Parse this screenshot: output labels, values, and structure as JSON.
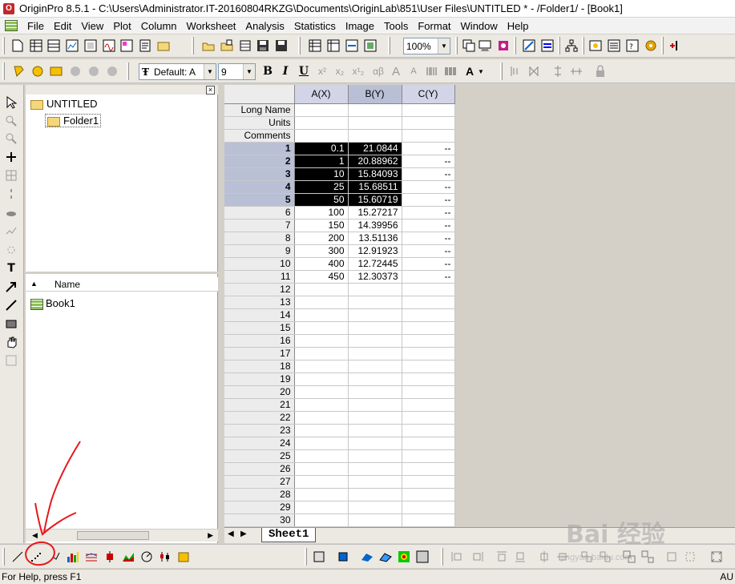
{
  "window": {
    "title": "OriginPro 8.5.1 - C:\\Users\\Administrator.IT-20160804RKZG\\Documents\\OriginLab\\851\\User Files\\UNTITLED * - /Folder1/ - [Book1]"
  },
  "menu": [
    "File",
    "Edit",
    "View",
    "Plot",
    "Column",
    "Worksheet",
    "Analysis",
    "Statistics",
    "Image",
    "Tools",
    "Format",
    "Window",
    "Help"
  ],
  "toolbar": {
    "zoom": "100%",
    "font_name": "Default: A",
    "font_size": "9",
    "bold": "B",
    "italic": "I",
    "underline": "U",
    "greek": "αβ",
    "font_grow": "A",
    "font_shrink": "A"
  },
  "project_explorer": {
    "root": "UNTITLED",
    "folder": "Folder1",
    "name_header": "Name",
    "items": [
      "Book1"
    ]
  },
  "worksheet": {
    "columns": [
      "A(X)",
      "B(Y)",
      "C(Y)"
    ],
    "meta_rows": [
      "Long Name",
      "Units",
      "Comments"
    ],
    "rows": [
      {
        "n": "1",
        "a": "0.1",
        "b": "21.0844",
        "c": "--"
      },
      {
        "n": "2",
        "a": "1",
        "b": "20.88962",
        "c": "--"
      },
      {
        "n": "3",
        "a": "10",
        "b": "15.84093",
        "c": "--"
      },
      {
        "n": "4",
        "a": "25",
        "b": "15.68511",
        "c": "--"
      },
      {
        "n": "5",
        "a": "50",
        "b": "15.60719",
        "c": "--"
      },
      {
        "n": "6",
        "a": "100",
        "b": "15.27217",
        "c": "--"
      },
      {
        "n": "7",
        "a": "150",
        "b": "14.39956",
        "c": "--"
      },
      {
        "n": "8",
        "a": "200",
        "b": "13.51136",
        "c": "--"
      },
      {
        "n": "9",
        "a": "300",
        "b": "12.91923",
        "c": "--"
      },
      {
        "n": "10",
        "a": "400",
        "b": "12.72445",
        "c": "--"
      },
      {
        "n": "11",
        "a": "450",
        "b": "12.30373",
        "c": "--"
      },
      {
        "n": "12",
        "a": "",
        "b": "",
        "c": ""
      },
      {
        "n": "13",
        "a": "",
        "b": "",
        "c": ""
      },
      {
        "n": "14",
        "a": "",
        "b": "",
        "c": ""
      },
      {
        "n": "15",
        "a": "",
        "b": "",
        "c": ""
      },
      {
        "n": "16",
        "a": "",
        "b": "",
        "c": ""
      },
      {
        "n": "17",
        "a": "",
        "b": "",
        "c": ""
      },
      {
        "n": "18",
        "a": "",
        "b": "",
        "c": ""
      },
      {
        "n": "19",
        "a": "",
        "b": "",
        "c": ""
      },
      {
        "n": "20",
        "a": "",
        "b": "",
        "c": ""
      },
      {
        "n": "21",
        "a": "",
        "b": "",
        "c": ""
      },
      {
        "n": "22",
        "a": "",
        "b": "",
        "c": ""
      },
      {
        "n": "23",
        "a": "",
        "b": "",
        "c": ""
      },
      {
        "n": "24",
        "a": "",
        "b": "",
        "c": ""
      },
      {
        "n": "25",
        "a": "",
        "b": "",
        "c": ""
      },
      {
        "n": "26",
        "a": "",
        "b": "",
        "c": ""
      },
      {
        "n": "27",
        "a": "",
        "b": "",
        "c": ""
      },
      {
        "n": "28",
        "a": "",
        "b": "",
        "c": ""
      },
      {
        "n": "29",
        "a": "",
        "b": "",
        "c": ""
      },
      {
        "n": "30",
        "a": "",
        "b": "",
        "c": ""
      }
    ],
    "selected_rows": [
      "1",
      "2",
      "3",
      "4",
      "5"
    ],
    "selected_column": "B(Y)",
    "sheet_tab": "Sheet1"
  },
  "status": {
    "left": "For Help, press F1",
    "right": "AU"
  },
  "watermark": {
    "main": "Bai 经验",
    "sub": "jingyan.baidu.com"
  }
}
